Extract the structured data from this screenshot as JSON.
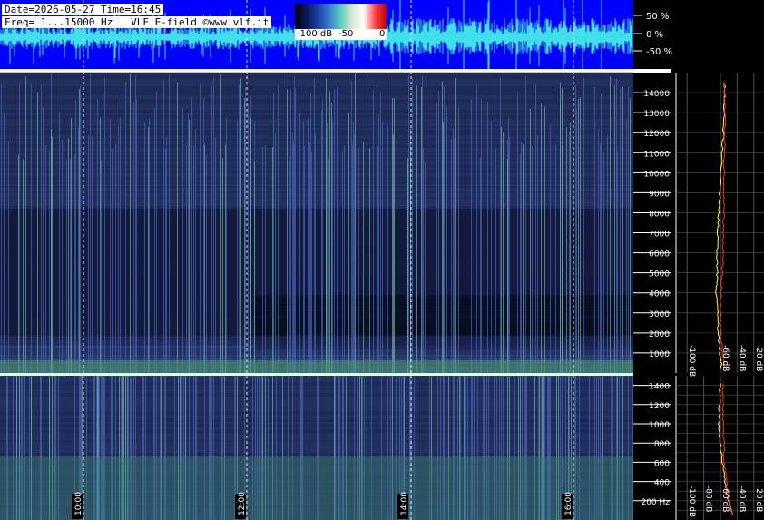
{
  "header": {
    "line1": "Date=2026-05-27 Time=16:45",
    "line2": "Freq= 1...15000 Hz   VLF E-field ©www.vlf.it"
  },
  "colorbar": {
    "labels": [
      "-100 dB",
      "-50",
      "0"
    ],
    "stops": [
      "#000000",
      "#0a1a5a",
      "#1a3fa0",
      "#3a7fd0",
      "#5ad0c0",
      "#d8e8d0",
      "#ffffff",
      "#ff4040",
      "#c00000"
    ]
  },
  "chart_data": [
    {
      "type": "line",
      "panel": "waveform",
      "y_ticks": [
        "50 %",
        "0 %",
        "-50 %"
      ],
      "ylim": [
        -100,
        100
      ],
      "colors": {
        "background": "#0000ff",
        "trace": "#3fe0e8"
      }
    },
    {
      "type": "heatmap",
      "panel": "spectrogram-full",
      "x_ticks": [
        "10:00",
        "12:00",
        "14:00",
        "16:00"
      ],
      "x_range": [
        "09:00",
        "16:45"
      ],
      "y_ticks": [
        1000,
        2000,
        3000,
        4000,
        5000,
        6000,
        7000,
        8000,
        9000,
        10000,
        11000,
        12000,
        13000,
        14000
      ],
      "ylim": [
        0,
        15000
      ]
    },
    {
      "type": "heatmap",
      "panel": "spectrogram-low",
      "y_ticks": [
        "200 Hz",
        "400",
        "600",
        "800",
        "1000",
        "1200",
        "1400"
      ],
      "ylim": [
        0,
        1500
      ]
    },
    {
      "type": "line",
      "panel": "spectrum-full",
      "x_ticks": [
        "-100 dB",
        "-60 dB",
        "-40 dB",
        "-20 dB"
      ],
      "xlim": [
        -110,
        -10
      ],
      "series": [
        {
          "color": "#ffff40",
          "x": [
            -58,
            -60,
            -62,
            -63,
            -64,
            -65,
            -64,
            -64,
            -63,
            -62,
            -60,
            -58,
            -56,
            -55,
            -55
          ],
          "y": [
            200,
            800,
            1600,
            2500,
            3400,
            4200,
            5000,
            6000,
            7000,
            8000,
            9500,
            11000,
            12500,
            13800,
            14600
          ]
        },
        {
          "color": "#ff3030",
          "x": [
            -54,
            -57,
            -59,
            -60,
            -60,
            -59,
            -58,
            -57,
            -57,
            -56,
            -56,
            -55,
            -55,
            -55,
            -55
          ],
          "y": [
            200,
            800,
            1600,
            2500,
            3400,
            4200,
            5000,
            6000,
            7000,
            8000,
            9500,
            11000,
            12500,
            13800,
            14600
          ]
        }
      ]
    },
    {
      "type": "line",
      "panel": "spectrum-low",
      "x_ticks": [
        "-100 dB",
        "-80 dB",
        "-60 dB",
        "-40 dB",
        "-20 dB"
      ],
      "xlim": [
        -110,
        -10
      ],
      "series": [
        {
          "color": "#ffff40",
          "x": [
            -45,
            -50,
            -55,
            -58,
            -60,
            -62,
            -61,
            -60
          ],
          "y": [
            50,
            200,
            400,
            600,
            800,
            1000,
            1200,
            1450
          ]
        },
        {
          "color": "#ff3030",
          "x": [
            -46,
            -50,
            -53,
            -55,
            -56,
            -57,
            -57,
            -57
          ],
          "y": [
            50,
            200,
            400,
            600,
            800,
            1000,
            1200,
            1450
          ]
        }
      ]
    }
  ]
}
